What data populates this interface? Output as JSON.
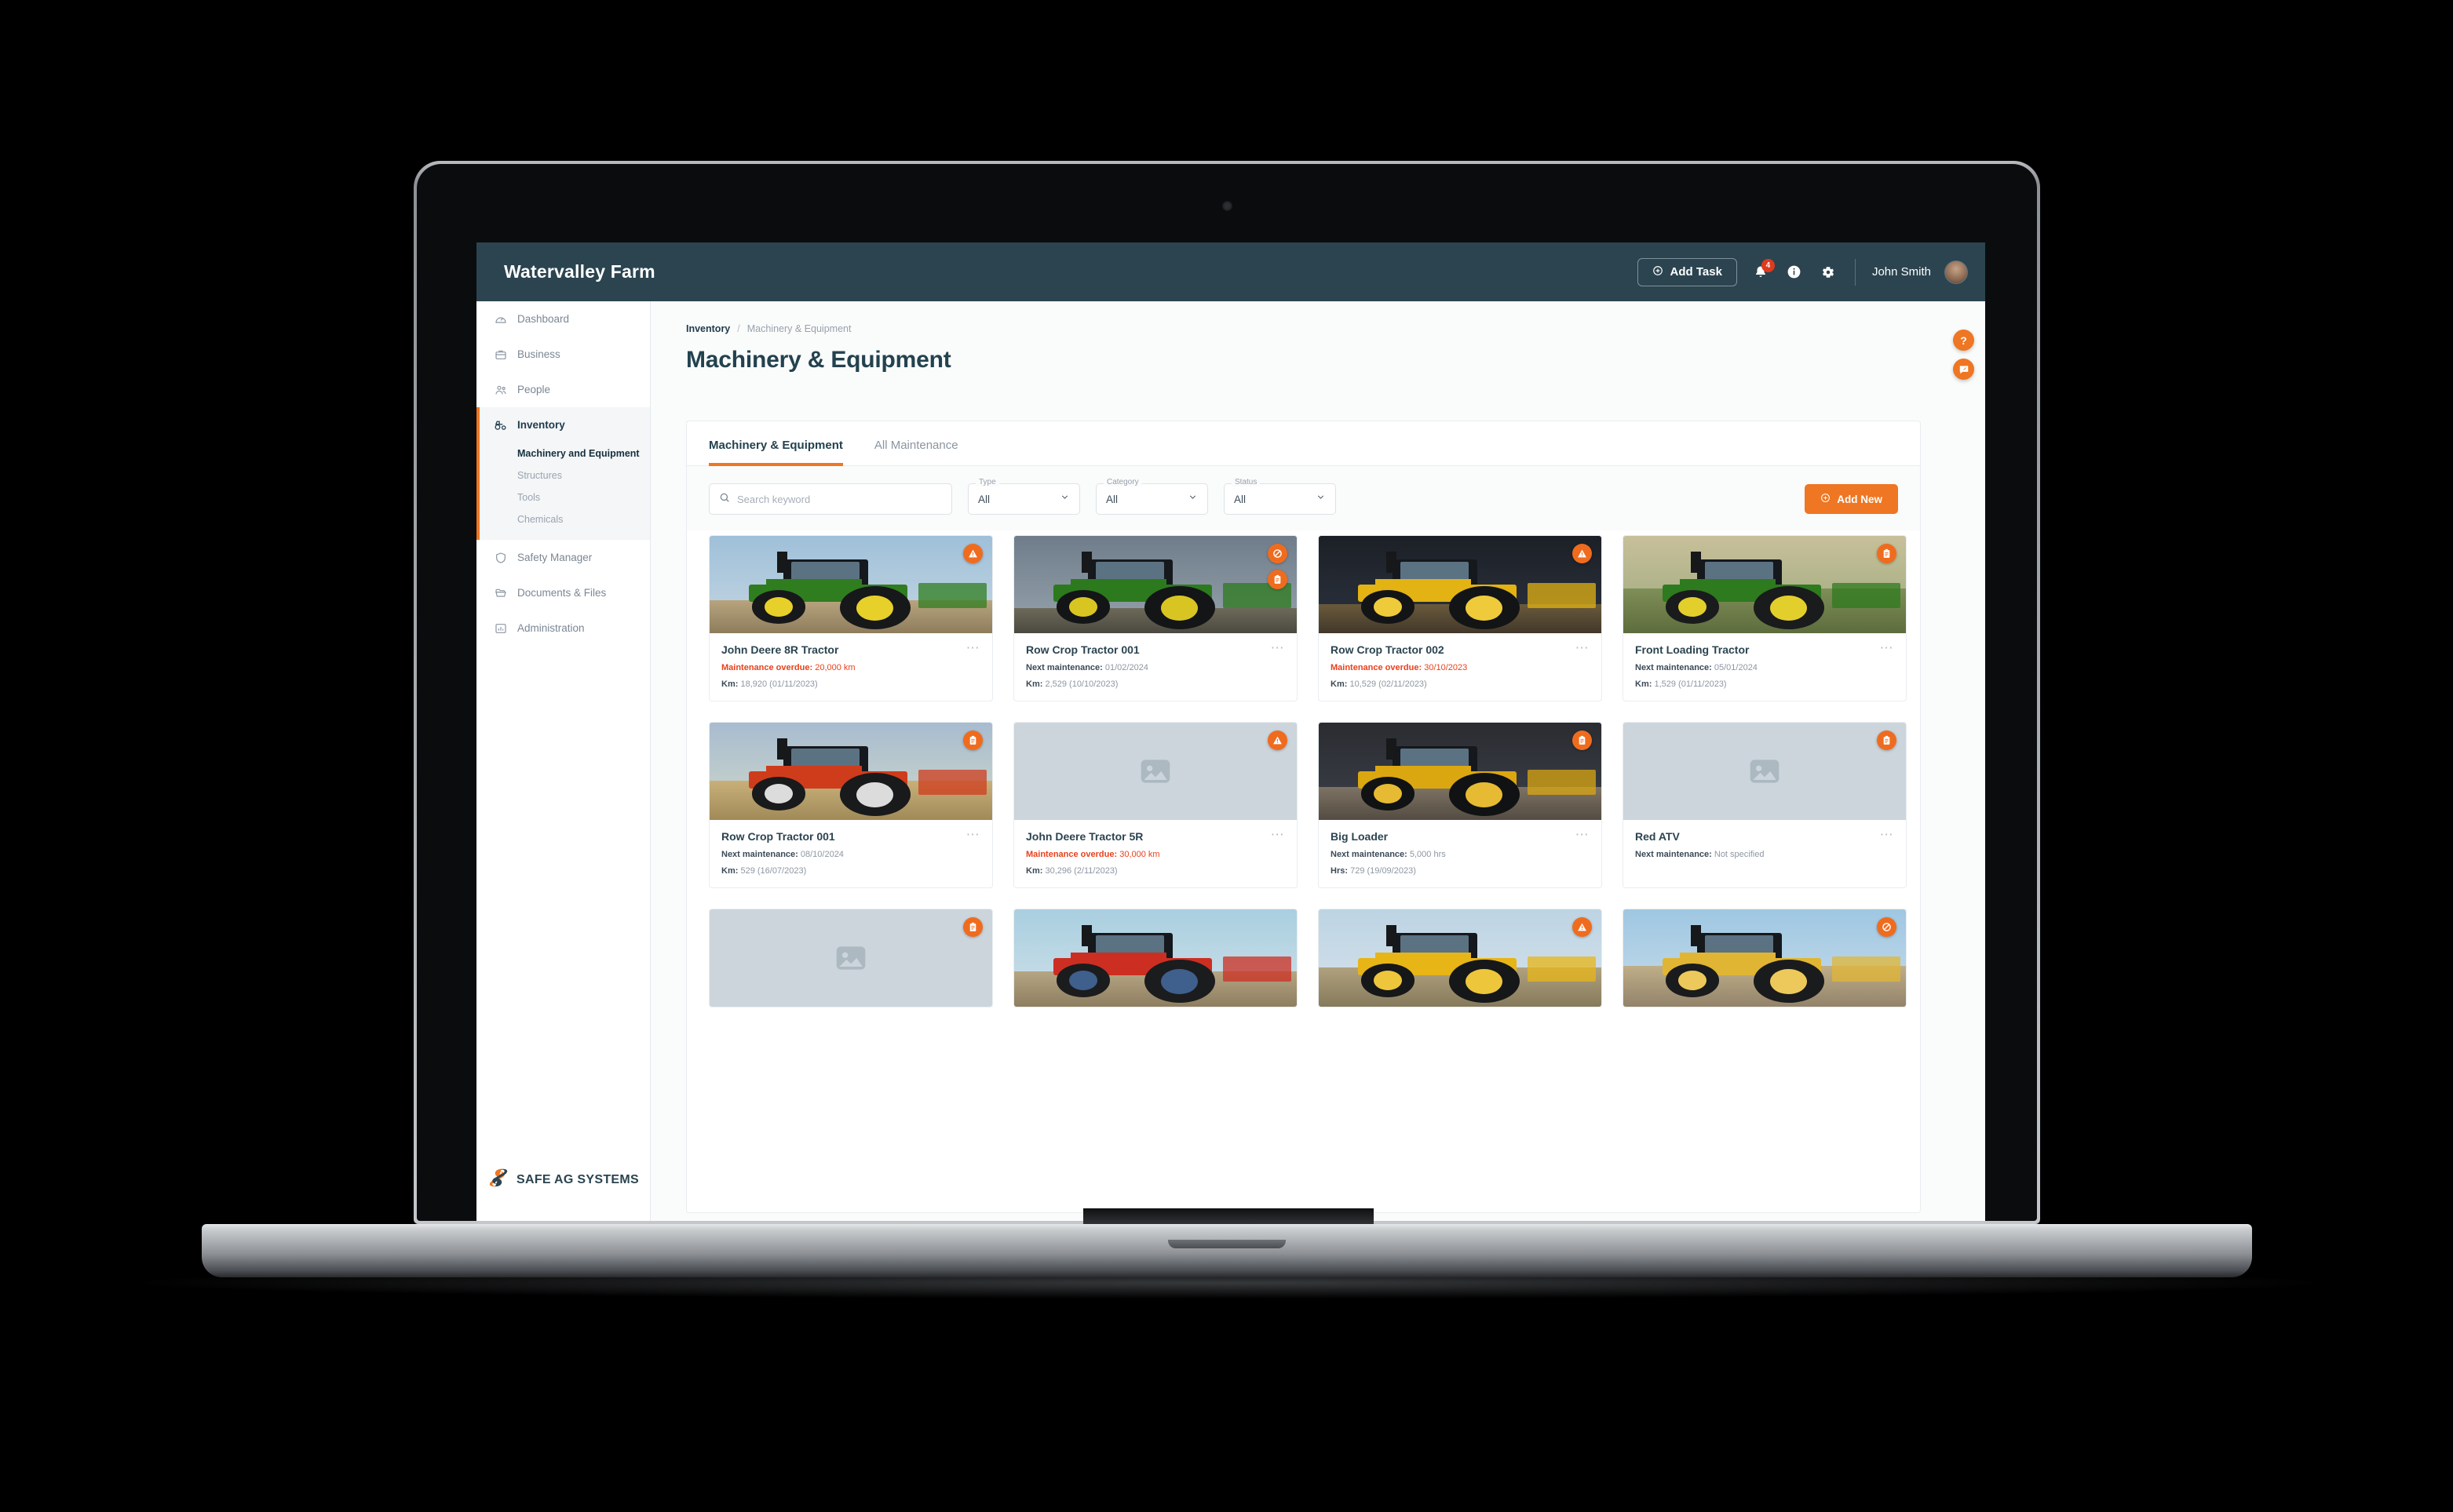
{
  "header": {
    "app_title": "Watervalley Farm",
    "add_task_label": "Add Task",
    "notification_count": "4",
    "user_name": "John Smith",
    "icons": {
      "bell": "bell-icon",
      "info": "info-icon",
      "gear": "gear-icon"
    }
  },
  "sidebar": {
    "items": [
      {
        "label": "Dashboard",
        "icon": "gauge-icon"
      },
      {
        "label": "Business",
        "icon": "briefcase-icon"
      },
      {
        "label": "People",
        "icon": "people-icon"
      },
      {
        "label": "Inventory",
        "icon": "tractor-icon",
        "active": true
      },
      {
        "label": "Safety Manager",
        "icon": "shield-icon"
      },
      {
        "label": "Documents & Files",
        "icon": "folder-icon"
      },
      {
        "label": "Administration",
        "icon": "chart-icon"
      }
    ],
    "subitems": [
      {
        "label": "Machinery and Equipment",
        "active": true
      },
      {
        "label": "Structures",
        "active": false
      },
      {
        "label": "Tools",
        "active": false
      },
      {
        "label": "Chemicals",
        "active": false
      }
    ],
    "brand": "SAFE AG SYSTEMS"
  },
  "breadcrumb": {
    "parent": "Inventory",
    "separator": "/",
    "current": "Machinery & Equipment"
  },
  "page_title": "Machinery & Equipment",
  "tabs": [
    {
      "label": "Machinery & Equipment",
      "active": true
    },
    {
      "label": "All Maintenance",
      "active": false
    }
  ],
  "filters": {
    "search_placeholder": "Search keyword",
    "search_value": "",
    "type": {
      "label": "Type",
      "value": "All"
    },
    "category": {
      "label": "Category",
      "value": "All"
    },
    "status": {
      "label": "Status",
      "value": "All"
    },
    "add_new_label": "Add New"
  },
  "floating": {
    "help": "?",
    "feedback": "feedback-icon"
  },
  "colors": {
    "accent": "#ef7622",
    "header_bg": "#2b4450",
    "overdue": "#e8411c",
    "badge": "#e03a1e"
  },
  "cards": [
    {
      "title": "John Deere 8R Tractor",
      "status_label": "Maintenance overdue:",
      "status_value": "20,000 km",
      "overdue": true,
      "metric_label": "Km:",
      "metric_value": "18,920 (01/11/2023)",
      "badges": [
        "warning-icon"
      ],
      "image": "green-tractor-field"
    },
    {
      "title": "Row Crop Tractor 001",
      "status_label": "Next maintenance:",
      "status_value": "01/02/2024",
      "overdue": false,
      "metric_label": "Km:",
      "metric_value": "2,529 (10/10/2023)",
      "badges": [
        "prohibited-icon",
        "clipboard-icon"
      ],
      "image": "green-tractor-dusk"
    },
    {
      "title": "Row Crop Tractor 002",
      "status_label": "Maintenance overdue:",
      "status_value": "30/10/2023",
      "overdue": true,
      "metric_label": "Km:",
      "metric_value": "10,529  (02/11/2023)",
      "badges": [
        "warning-icon"
      ],
      "image": "yellow-tractor-seeder"
    },
    {
      "title": "Front Loading Tractor",
      "status_label": "Next maintenance:",
      "status_value": "05/01/2024",
      "overdue": false,
      "metric_label": "Km:",
      "metric_value": "1,529 (01/11/2023)",
      "badges": [
        "clipboard-icon"
      ],
      "image": "green-loader-paddock"
    },
    {
      "title": "Row Crop Tractor 001",
      "status_label": "Next maintenance:",
      "status_value": "08/10/2024",
      "overdue": false,
      "metric_label": "Km:",
      "metric_value": "529  (16/07/2023)",
      "badges": [
        "clipboard-icon"
      ],
      "image": "red-baler-harvest"
    },
    {
      "title": "John Deere Tractor 5R",
      "status_label": "Maintenance overdue:",
      "status_value": "30,000 km",
      "overdue": true,
      "metric_label": "Km:",
      "metric_value": "30,296 (2/11/2023)",
      "badges": [
        "warning-icon"
      ],
      "image": "placeholder"
    },
    {
      "title": "Big Loader",
      "status_label": "Next maintenance:",
      "status_value": "5,000 hrs",
      "overdue": false,
      "metric_label": "Hrs:",
      "metric_value": "729 (19/09/2023)",
      "badges": [
        "clipboard-icon"
      ],
      "image": "yellow-grader"
    },
    {
      "title": "Red ATV",
      "status_label": "Next maintenance:",
      "status_value": "Not specified",
      "overdue": false,
      "metric_label": "",
      "metric_value": "",
      "badges": [
        "clipboard-icon"
      ],
      "image": "placeholder"
    },
    {
      "title": "",
      "status_label": "",
      "status_value": "",
      "overdue": false,
      "metric_label": "",
      "metric_value": "",
      "badges": [
        "clipboard-icon"
      ],
      "image": "placeholder"
    },
    {
      "title": "",
      "status_label": "",
      "status_value": "",
      "overdue": false,
      "metric_label": "",
      "metric_value": "",
      "badges": [],
      "image": "red-tractor-yard"
    },
    {
      "title": "",
      "status_label": "",
      "status_value": "",
      "overdue": false,
      "metric_label": "",
      "metric_value": "",
      "badges": [
        "warning-icon"
      ],
      "image": "yellow-backhoe"
    },
    {
      "title": "",
      "status_label": "",
      "status_value": "",
      "overdue": false,
      "metric_label": "",
      "metric_value": "",
      "badges": [
        "prohibited-icon"
      ],
      "image": "yellow-excavator"
    }
  ]
}
